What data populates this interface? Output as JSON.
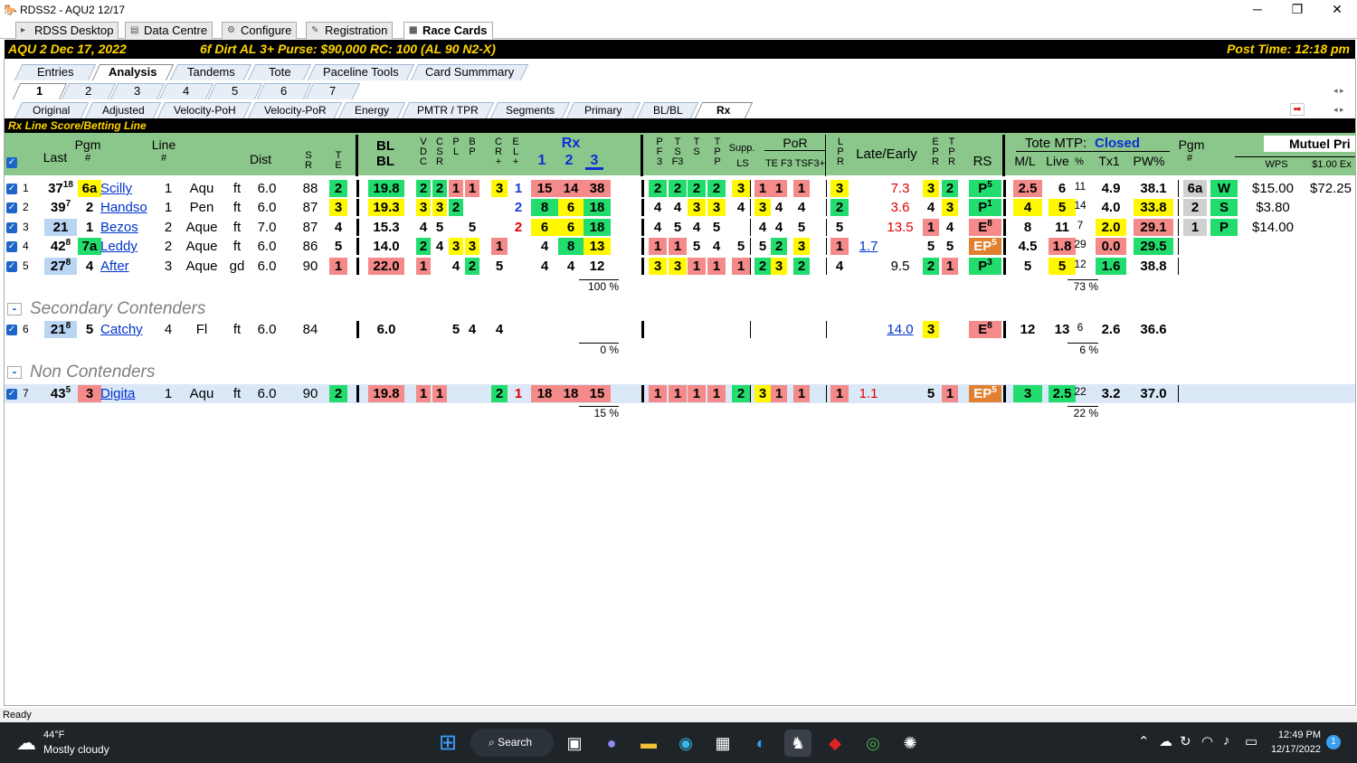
{
  "window": {
    "title": "RDSS2 - AQU2  12/17",
    "minimize": "─",
    "maximize": "❐",
    "close": "✕"
  },
  "app_tabs": [
    {
      "label": "RDSS Desktop",
      "icon": "horse-icon"
    },
    {
      "label": "Data Centre",
      "icon": "database-icon"
    },
    {
      "label": "Configure",
      "icon": "gear-icon"
    },
    {
      "label": "Registration",
      "icon": "key-icon"
    },
    {
      "label": "Race Cards",
      "icon": "card-icon"
    }
  ],
  "race": {
    "left": "AQU  2   Dec 17, 2022",
    "mid": "6f  Dirt   AL  3+   Purse: $90,000   RC: 100  (AL 90 N2-X)",
    "post": "Post Time: 12:18 pm"
  },
  "view_tabs": [
    "Entries",
    "Analysis",
    "Tandems",
    "Tote",
    "Paceline Tools",
    "Card Summmary"
  ],
  "race_tabs": [
    "1",
    "2",
    "3",
    "4",
    "5",
    "6",
    "7"
  ],
  "sub_tabs": [
    "Original",
    "Adjusted",
    "Velocity-PoH",
    "Velocity-PoR",
    "Energy",
    "PMTR / TPR",
    "Segments",
    "Primary",
    "BL/BL",
    "Rx"
  ],
  "panel_title": "Rx Line Score/Betting Line",
  "headers": {
    "last": "Last",
    "pgm": "Pgm",
    "pgm_hash": "#",
    "line": "Line",
    "line_hash": "#",
    "dist": "Dist",
    "sr": "S\nR",
    "te": "T\nE",
    "bl1": "BL",
    "bl2": "BL",
    "vdc": "V\nD\nC",
    "csr": "C\nS\nR",
    "pl": "P\nL",
    "bp": "B\nP",
    "cr": "C\nR\n+",
    "el": "E\nL\n+",
    "rx": "Rx",
    "rx1": "1",
    "rx2": "2",
    "rx3": "3",
    "pf": "P\nF\n3",
    "ts": "T\nS\nF3",
    "t": "T\nS",
    "tp": "T\nP\nP",
    "supp": "Supp.",
    "ls": "LS",
    "por": "PoR",
    "por_sub": "TE F3 TSF3+",
    "lpr": "L\nP\nR",
    "late": "Late/Early",
    "epr": "E\nP\nR",
    "tpr": "T\nP\nR",
    "rs": "RS",
    "tote_label": "Tote MTP:",
    "tote_status": "Closed",
    "ml": "M/L",
    "live": "Live",
    "pct": "%",
    "tx1": "Tx1",
    "pw": "PW%",
    "pgm2": "Pgm",
    "pgm2h": "#",
    "mutuel": "Mutuel Pri",
    "wps": "WPS",
    "ex": "$1.00 Ex"
  },
  "sections": {
    "secondary": "Secondary Contenders",
    "non": "Non Contenders",
    "collapse": "-"
  },
  "rows": [
    {
      "n": "1",
      "last": "37",
      "lastsup": "18",
      "pgm": "6a",
      "line": "1",
      "name": "Scilly",
      "trk": "Aqu",
      "surf": "ft",
      "dist": "6.0",
      "sr": "88",
      "te": "2",
      "bl": "19.8",
      "v1": "2",
      "v2": "2",
      "v3": "1",
      "v4": "1",
      "v5": "3",
      "v6": "1",
      "rx1": "15",
      "rx2": "14",
      "rx3": "38",
      "p1": "2",
      "p2": "2",
      "p3": "2",
      "p4": "2",
      "supp": "3",
      "po1": "1",
      "po2": "1",
      "po3": "1",
      "lpr": "3",
      "late": "",
      "early": "7.3",
      "e1": "3",
      "e2": "2",
      "rs": "P",
      "rssup": "5",
      "ml": "2.5",
      "live": "6",
      "pct": "11",
      "tx": "4.9",
      "pw": "38.1",
      "fin_pgm": "6a",
      "fin_pos": "W",
      "wps": "$15.00",
      "ex": "$72.25"
    },
    {
      "n": "2",
      "last": "39",
      "lastsup": "7",
      "pgm": "2",
      "line": "1",
      "name": "Handso",
      "trk": "Pen",
      "surf": "ft",
      "dist": "6.0",
      "sr": "87",
      "te": "3",
      "bl": "19.3",
      "v1": "3",
      "v2": "3",
      "v3": "2",
      "v4": "",
      "v5": "",
      "v6": "2",
      "rx1": "8",
      "rx2": "6",
      "rx3": "18",
      "p1": "4",
      "p2": "4",
      "p3": "3",
      "p4": "3",
      "supp": "4",
      "po1": "3",
      "po2": "4",
      "po3": "4",
      "lpr": "2",
      "late": "",
      "early": "3.6",
      "e1": "4",
      "e2": "3",
      "rs": "P",
      "rssup": "1",
      "ml": "4",
      "live": "5",
      "pct": "14",
      "tx": "4.0",
      "pw": "33.8",
      "fin_pgm": "2",
      "fin_pos": "S",
      "wps": "$3.80",
      "ex": ""
    },
    {
      "n": "3",
      "last": "21",
      "lastsup": "",
      "pgm": "1",
      "line": "2",
      "name": "Bezos",
      "trk": "Aque",
      "surf": "ft",
      "dist": "7.0",
      "sr": "87",
      "te": "4",
      "bl": "15.3",
      "v1": "4",
      "v2": "5",
      "v3": "",
      "v4": "5",
      "v5": "",
      "v6": "2",
      "rx1": "6",
      "rx2": "6",
      "rx3": "18",
      "p1": "4",
      "p2": "5",
      "p3": "4",
      "p4": "5",
      "supp": "",
      "po1": "4",
      "po2": "4",
      "po3": "5",
      "lpr": "5",
      "late": "",
      "early": "13.5",
      "e1": "1",
      "e2": "4",
      "rs": "E",
      "rssup": "8",
      "ml": "8",
      "live": "11",
      "pct": "7",
      "tx": "2.0",
      "pw": "29.1",
      "fin_pgm": "1",
      "fin_pos": "P",
      "wps": "$14.00",
      "ex": ""
    },
    {
      "n": "4",
      "last": "42",
      "lastsup": "8",
      "pgm": "7a",
      "line": "2",
      "name": "Leddy",
      "trk": "Aque",
      "surf": "ft",
      "dist": "6.0",
      "sr": "86",
      "te": "5",
      "bl": "14.0",
      "v1": "2",
      "v2": "4",
      "v3": "3",
      "v4": "3",
      "v5": "1",
      "v6": "",
      "rx1": "4",
      "rx2": "8",
      "rx3": "13",
      "p1": "1",
      "p2": "1",
      "p3": "5",
      "p4": "4",
      "supp": "5",
      "po1": "5",
      "po2": "2",
      "po3": "3",
      "lpr": "1",
      "late": "1.7",
      "early": "",
      "e1": "5",
      "e2": "5",
      "rs": "EP",
      "rssup": "5",
      "ml": "4.5",
      "live": "1.8",
      "pct": "29",
      "tx": "0.0",
      "pw": "29.5"
    },
    {
      "n": "5",
      "last": "27",
      "lastsup": "8",
      "pgm": "4",
      "line": "3",
      "name": "After",
      "trk": "Aque",
      "surf": "gd",
      "dist": "6.0",
      "sr": "90",
      "te": "1",
      "bl": "22.0",
      "v1": "1",
      "v2": "",
      "v3": "4",
      "v4": "2",
      "v5": "5",
      "v6": "",
      "rx1": "4",
      "rx2": "4",
      "rx3": "12",
      "p1": "3",
      "p2": "3",
      "p3": "1",
      "p4": "1",
      "supp": "1",
      "po1": "2",
      "po2": "3",
      "po3": "2",
      "lpr": "4",
      "late": "",
      "early": "9.5",
      "e1": "2",
      "e2": "1",
      "rs": "P",
      "rssup": "3",
      "ml": "5",
      "live": "5",
      "pct": "12",
      "tx": "1.6",
      "pw": "38.8"
    },
    {
      "n": "6",
      "last": "21",
      "lastsup": "8",
      "pgm": "5",
      "line": "4",
      "name": "Catchy",
      "trk": "Fl",
      "surf": "ft",
      "dist": "6.0",
      "sr": "84",
      "te": "",
      "bl": "6.0",
      "v1": "",
      "v2": "",
      "v3": "5",
      "v4": "4",
      "v5": "4",
      "v6": "",
      "early": "14.0",
      "e1": "3",
      "rs": "E",
      "rssup": "8",
      "ml": "12",
      "live": "13",
      "pct": "6",
      "tx": "2.6",
      "pw": "36.6"
    },
    {
      "n": "7",
      "last": "43",
      "lastsup": "5",
      "pgm": "3",
      "line": "1",
      "name": "Digita",
      "trk": "Aqu",
      "surf": "ft",
      "dist": "6.0",
      "sr": "90",
      "te": "2",
      "bl": "19.8",
      "v1": "1",
      "v2": "1",
      "v5": "2",
      "v6": "1",
      "rx1": "18",
      "rx2": "18",
      "rx3": "15",
      "p1": "1",
      "p2": "1",
      "p3": "1",
      "p4": "1",
      "supp": "2",
      "po1": "3",
      "po2": "1",
      "po3": "1",
      "lpr": "1",
      "late": "1.1",
      "e1": "5",
      "e2": "1",
      "rs": "EP",
      "rssup": "5",
      "ml": "3",
      "live": "2.5",
      "pct": "22",
      "tx": "3.2",
      "pw": "37.0"
    }
  ],
  "pcts": {
    "g1_rx": "100 %",
    "g1_live": "73 %",
    "g2_rx": "0 %",
    "g2_live": "6 %",
    "g3_rx": "15 %",
    "g3_live": "22 %"
  },
  "status": "Ready",
  "taskbar": {
    "temp": "44°F",
    "weather": "Mostly cloudy",
    "search": "Search",
    "time": "12:49 PM",
    "date": "12/17/2022",
    "badge": "1"
  }
}
